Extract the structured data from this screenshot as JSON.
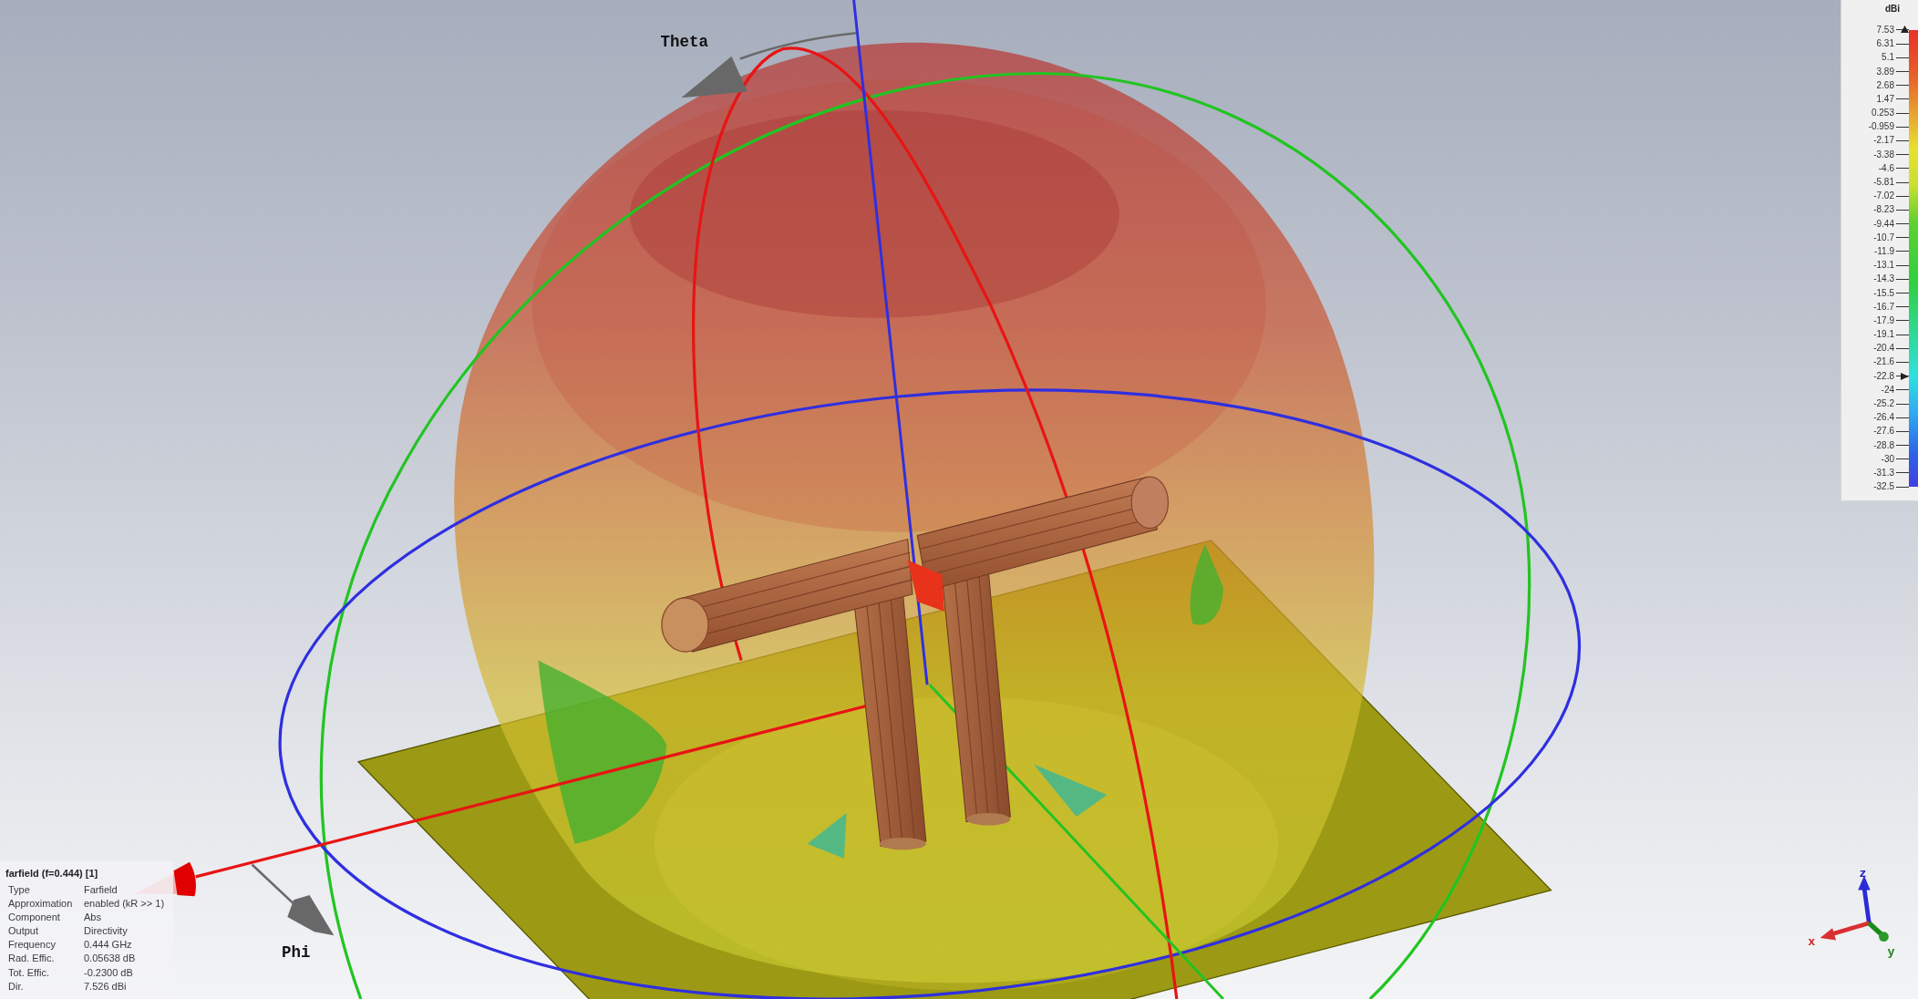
{
  "scene": {
    "theta_label": "Theta",
    "phi_label": "Phi"
  },
  "axes": {
    "x_label": "x",
    "y_label": "y",
    "z_label": "z"
  },
  "color_legend": {
    "unit": "dBi",
    "ticks": [
      {
        "label": "7.53",
        "kind": "max"
      },
      {
        "label": "6.31",
        "kind": "plain"
      },
      {
        "label": "5.1",
        "kind": "plain"
      },
      {
        "label": "3.89",
        "kind": "plain"
      },
      {
        "label": "2.68",
        "kind": "plain"
      },
      {
        "label": "1.47",
        "kind": "plain"
      },
      {
        "label": "0.253",
        "kind": "plain"
      },
      {
        "label": "-0.959",
        "kind": "plain"
      },
      {
        "label": "-2.17",
        "kind": "plain"
      },
      {
        "label": "-3.38",
        "kind": "plain"
      },
      {
        "label": "-4.6",
        "kind": "plain"
      },
      {
        "label": "-5.81",
        "kind": "plain"
      },
      {
        "label": "-7.02",
        "kind": "plain"
      },
      {
        "label": "-8.23",
        "kind": "plain"
      },
      {
        "label": "-9.44",
        "kind": "plain"
      },
      {
        "label": "-10.7",
        "kind": "plain"
      },
      {
        "label": "-11.9",
        "kind": "plain"
      },
      {
        "label": "-13.1",
        "kind": "plain"
      },
      {
        "label": "-14.3",
        "kind": "plain"
      },
      {
        "label": "-15.5",
        "kind": "plain"
      },
      {
        "label": "-16.7",
        "kind": "plain"
      },
      {
        "label": "-17.9",
        "kind": "plain"
      },
      {
        "label": "-19.1",
        "kind": "plain"
      },
      {
        "label": "-20.4",
        "kind": "plain"
      },
      {
        "label": "-21.6",
        "kind": "plain"
      },
      {
        "label": "-22.8",
        "kind": "threshold"
      },
      {
        "label": "-24",
        "kind": "plain"
      },
      {
        "label": "-25.2",
        "kind": "plain"
      },
      {
        "label": "-26.4",
        "kind": "plain"
      },
      {
        "label": "-27.6",
        "kind": "plain"
      },
      {
        "label": "-28.8",
        "kind": "plain"
      },
      {
        "label": "-30",
        "kind": "plain"
      },
      {
        "label": "-31.3",
        "kind": "plain"
      },
      {
        "label": "-32.5",
        "kind": "plain"
      }
    ]
  },
  "info_panel": {
    "title": "farfield (f=0.444) [1]",
    "rows": [
      {
        "label": "Type",
        "value": "Farfield"
      },
      {
        "label": "Approximation",
        "value": "enabled (kR >> 1)"
      },
      {
        "label": "Component",
        "value": "Abs"
      },
      {
        "label": "Output",
        "value": "Directivity"
      },
      {
        "label": "Frequency",
        "value": "0.444 GHz"
      },
      {
        "label": "Rad. Effic.",
        "value": "0.05638 dB"
      },
      {
        "label": "Tot. Effic.",
        "value": "-0.2300 dB"
      },
      {
        "label": "Dir.",
        "value": "7.526 dBi"
      }
    ]
  }
}
